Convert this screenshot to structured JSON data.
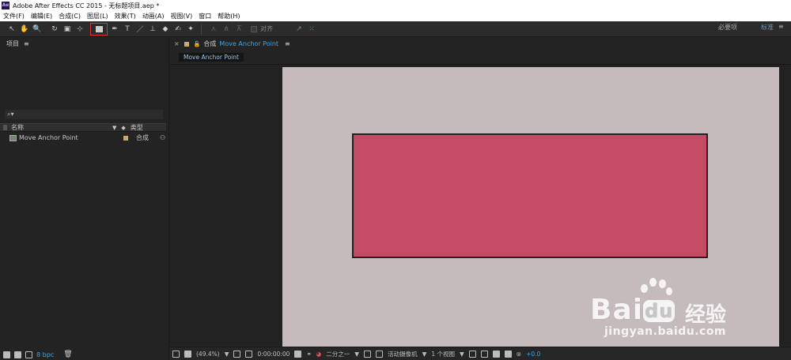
{
  "window": {
    "title": "Adobe After Effects CC 2015 - 无标题项目.aep *",
    "logo": "Ae"
  },
  "menu": [
    "文件(F)",
    "编辑(E)",
    "合成(C)",
    "图层(L)",
    "效果(T)",
    "动画(A)",
    "视图(V)",
    "窗口",
    "帮助(H)"
  ],
  "toolbar": {
    "tools": [
      {
        "name": "selection-tool-icon",
        "glyph": "↖"
      },
      {
        "name": "hand-tool-icon",
        "glyph": "✋"
      },
      {
        "name": "zoom-tool-icon",
        "glyph": "🔍"
      },
      {
        "name": "rotation-tool-icon",
        "glyph": "↻"
      },
      {
        "name": "camera-tool-icon",
        "glyph": "▣"
      },
      {
        "name": "pan-behind-tool-icon",
        "glyph": "⊹"
      }
    ],
    "tools_after": [
      {
        "name": "pen-tool-icon",
        "glyph": "✒"
      },
      {
        "name": "type-tool-icon",
        "glyph": "T"
      },
      {
        "name": "brush-tool-icon",
        "glyph": "／"
      },
      {
        "name": "clone-stamp-tool-icon",
        "glyph": "⊥"
      },
      {
        "name": "eraser-tool-icon",
        "glyph": "◆"
      },
      {
        "name": "roto-brush-tool-icon",
        "glyph": "✍"
      },
      {
        "name": "puppet-tool-icon",
        "glyph": "✦"
      }
    ],
    "snap_label": "对齐",
    "workspace_essentials": "必要项",
    "workspace_standard": "标准",
    "menu_glyph": "≡"
  },
  "project": {
    "title": "项目",
    "menu_glyph": "≡",
    "search_placeholder": "⌕▾",
    "col_name": "名称",
    "col_type": "类型",
    "item": {
      "name": "Move Anchor Point",
      "type": "合成"
    },
    "bpc": "8 bpc"
  },
  "composition": {
    "close": "×",
    "lock": "🔓",
    "label": "合成",
    "name": "Move Anchor Point",
    "menu_glyph": "≡",
    "tab": "Move Anchor Point"
  },
  "viewer_footer": {
    "zoom": "(49.4%)",
    "timecode": "0:00:00:00",
    "resolution": "二分之一",
    "camera": "活动摄像机",
    "views": "1 个视图",
    "exposure": "+0.0"
  },
  "watermark": {
    "brand": "Bai",
    "brand2": "du",
    "cn": "经验",
    "url": "jingyan.baidu.com"
  },
  "colors": {
    "canvas": "#c5bbbc",
    "shape_fill": "#c54b64",
    "accent": "#3fa6e8"
  }
}
